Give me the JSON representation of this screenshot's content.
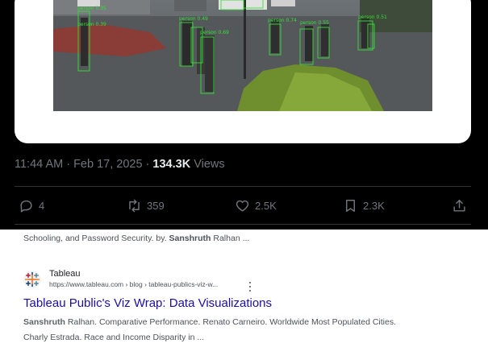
{
  "tweet": {
    "media": {
      "detections": [
        {
          "label": "person 0.35"
        },
        {
          "label": "person 0.39"
        },
        {
          "label": "person 0.49"
        },
        {
          "label": "person 0.69"
        },
        {
          "label": "person 0.74"
        },
        {
          "label": "person 0.55"
        },
        {
          "label": "person 0.51"
        }
      ]
    },
    "meta": {
      "time_date": "11:44 AM · Feb 17, 2025 · ",
      "views_count": "134.3K",
      "views_label": " Views"
    },
    "actions": {
      "replies": "4",
      "reposts": "359",
      "likes": "2.5K",
      "bookmarks": "2.3K"
    },
    "icons": [
      "reply-icon",
      "repost-icon",
      "heart-icon",
      "bookmark-icon",
      "share-icon"
    ]
  },
  "search": {
    "top_snippet": {
      "before": "Schooling, and Password Security. by. ",
      "bold": "Sanshruth",
      "after": " Ralhan ..."
    },
    "result": {
      "site_name": "Tableau",
      "url": "https://www.tableau.com › blog › tableau-publics-viz-w...",
      "title": "Tableau Public's Viz Wrap: Data Visualizations",
      "snippet_bold": "Sanshruth",
      "snippet_line1": " Ralhan. Comparative Performance. Renato Carneiro. Worldwide Most Populated Cities.",
      "snippet_line2": "Charly Estrada. Race and Income Disparity in ..."
    },
    "colors": {
      "title_link": "#1a0dab",
      "snippet_text": "#4d5156",
      "detection_box": "#34e034"
    }
  }
}
